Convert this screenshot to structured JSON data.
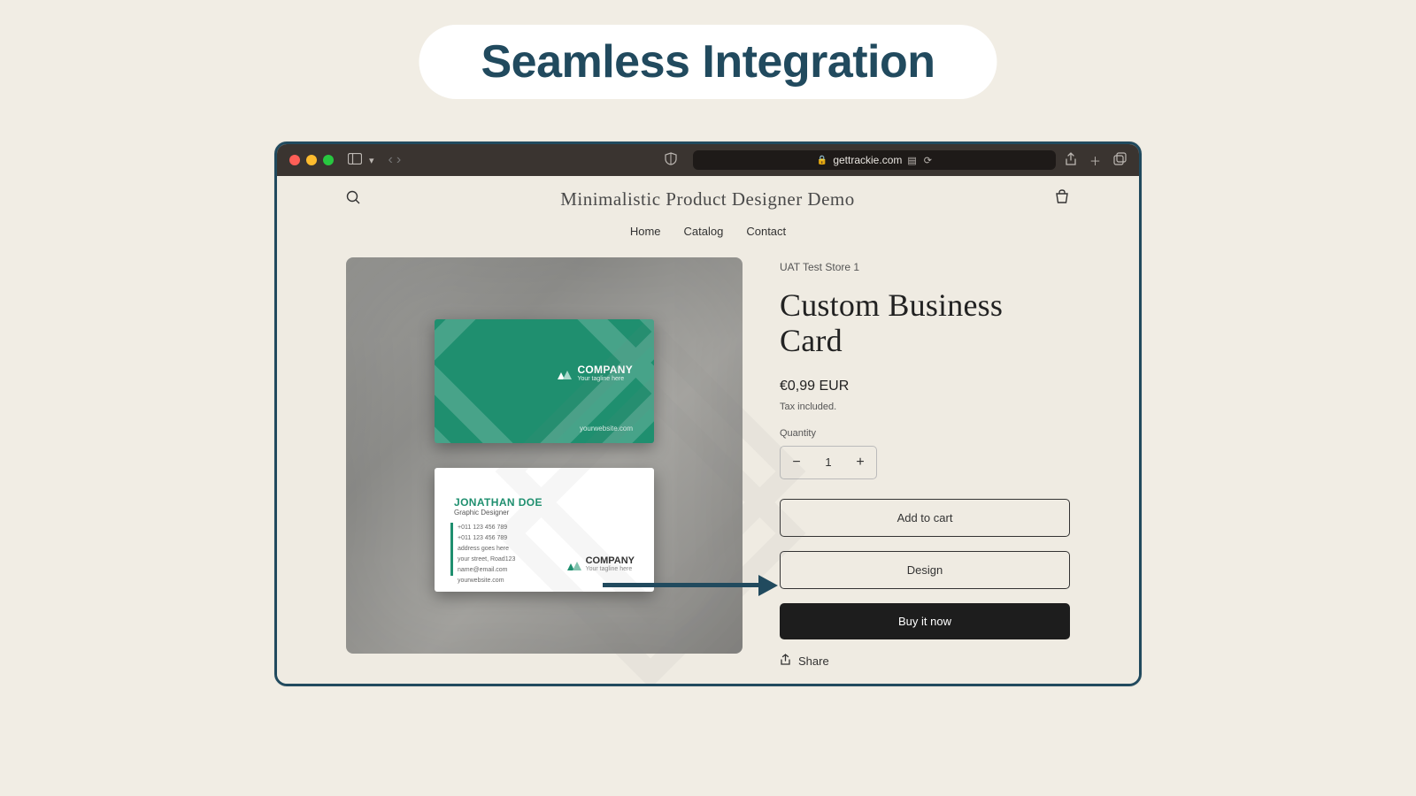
{
  "banner": {
    "title": "Seamless Integration"
  },
  "browser": {
    "url": "gettrackie.com"
  },
  "store": {
    "title": "Minimalistic Product Designer Demo",
    "nav": {
      "home": "Home",
      "catalog": "Catalog",
      "contact": "Contact"
    }
  },
  "card": {
    "company": "COMPANY",
    "tagline": "Your tagline here",
    "website": "yourwebsite.com",
    "name": "JONATHAN DOE",
    "role": "Graphic Designer",
    "phone1": "+011 123 456 789",
    "phone2": "+011 123 456 789",
    "addr1": "address goes here",
    "addr2": "your street, Road123",
    "email": "name@email.com",
    "site2": "yourwebsite.com"
  },
  "product": {
    "vendor": "UAT Test Store 1",
    "title": "Custom Business Card",
    "price": "€0,99 EUR",
    "tax": "Tax included.",
    "qty_label": "Quantity",
    "qty_value": "1",
    "add_to_cart": "Add to cart",
    "design": "Design",
    "buy_now": "Buy it now",
    "share": "Share"
  }
}
